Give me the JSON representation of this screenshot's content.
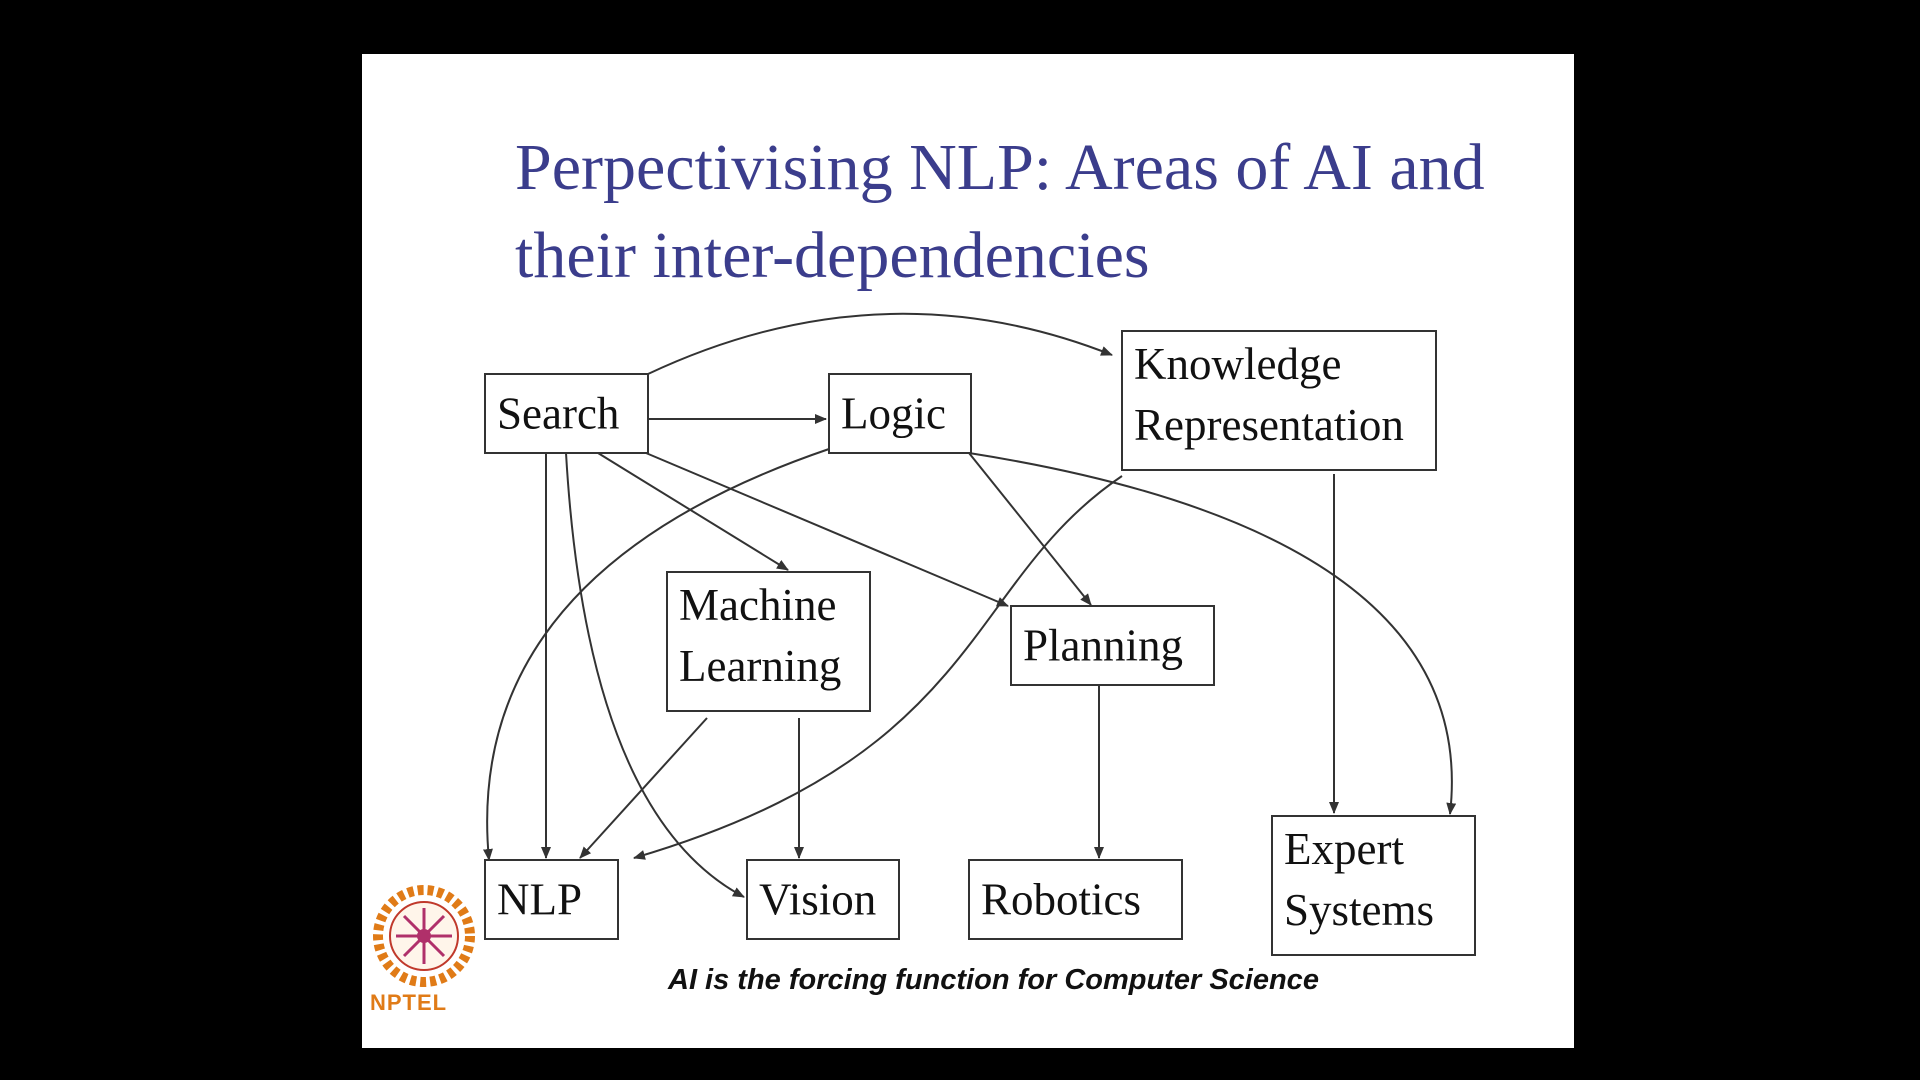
{
  "slide": {
    "title_line1": "Perpectivising NLP: Areas of AI and",
    "title_line2": "their inter-dependencies",
    "footer": "AI is the forcing function for Computer Science",
    "logo_text": "NPTEL"
  },
  "diagram": {
    "nodes": [
      {
        "id": "search",
        "lines": [
          "Search"
        ]
      },
      {
        "id": "logic",
        "lines": [
          "Logic"
        ]
      },
      {
        "id": "knowledge-representation",
        "lines": [
          "Knowledge",
          "Representation"
        ]
      },
      {
        "id": "machine-learning",
        "lines": [
          "Machine",
          "Learning"
        ]
      },
      {
        "id": "planning",
        "lines": [
          "Planning"
        ]
      },
      {
        "id": "nlp",
        "lines": [
          "NLP"
        ]
      },
      {
        "id": "vision",
        "lines": [
          "Vision"
        ]
      },
      {
        "id": "robotics",
        "lines": [
          "Robotics"
        ]
      },
      {
        "id": "expert-systems",
        "lines": [
          "Expert",
          "Systems"
        ]
      }
    ],
    "edges": [
      {
        "from": "search",
        "to": "knowledge-representation"
      },
      {
        "from": "search",
        "to": "logic"
      },
      {
        "from": "search",
        "to": "nlp"
      },
      {
        "from": "search",
        "to": "vision"
      },
      {
        "from": "search",
        "to": "machine-learning"
      },
      {
        "from": "search",
        "to": "planning"
      },
      {
        "from": "logic",
        "to": "nlp"
      },
      {
        "from": "logic",
        "to": "planning"
      },
      {
        "from": "logic",
        "to": "expert-systems"
      },
      {
        "from": "knowledge-representation",
        "to": "nlp"
      },
      {
        "from": "knowledge-representation",
        "to": "expert-systems"
      },
      {
        "from": "machine-learning",
        "to": "nlp"
      },
      {
        "from": "machine-learning",
        "to": "vision"
      },
      {
        "from": "planning",
        "to": "robotics"
      }
    ]
  },
  "colors": {
    "title": "#3b3d8c",
    "lines": "#333333",
    "logo": "#e07b17"
  }
}
